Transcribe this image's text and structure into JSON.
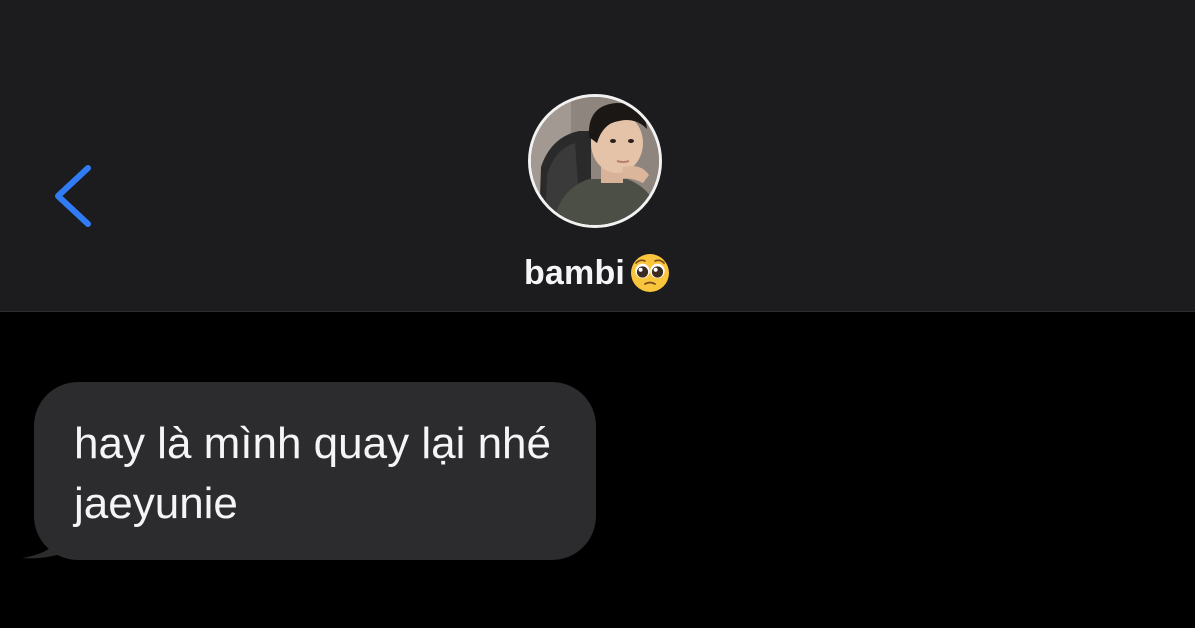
{
  "header": {
    "contact_name": "bambi",
    "name_emoji": "pleading-face-emoji",
    "avatar": "contact-avatar-photo",
    "back_icon": "chevron-left-icon",
    "accent_color": "#2f7cf6",
    "background": "#1c1c1e"
  },
  "thread": {
    "background": "#000000",
    "messages": [
      {
        "direction": "incoming",
        "text": "hay là mình quay lại nhé jaeyunie",
        "bubble_color": "#2c2c2e"
      }
    ]
  }
}
